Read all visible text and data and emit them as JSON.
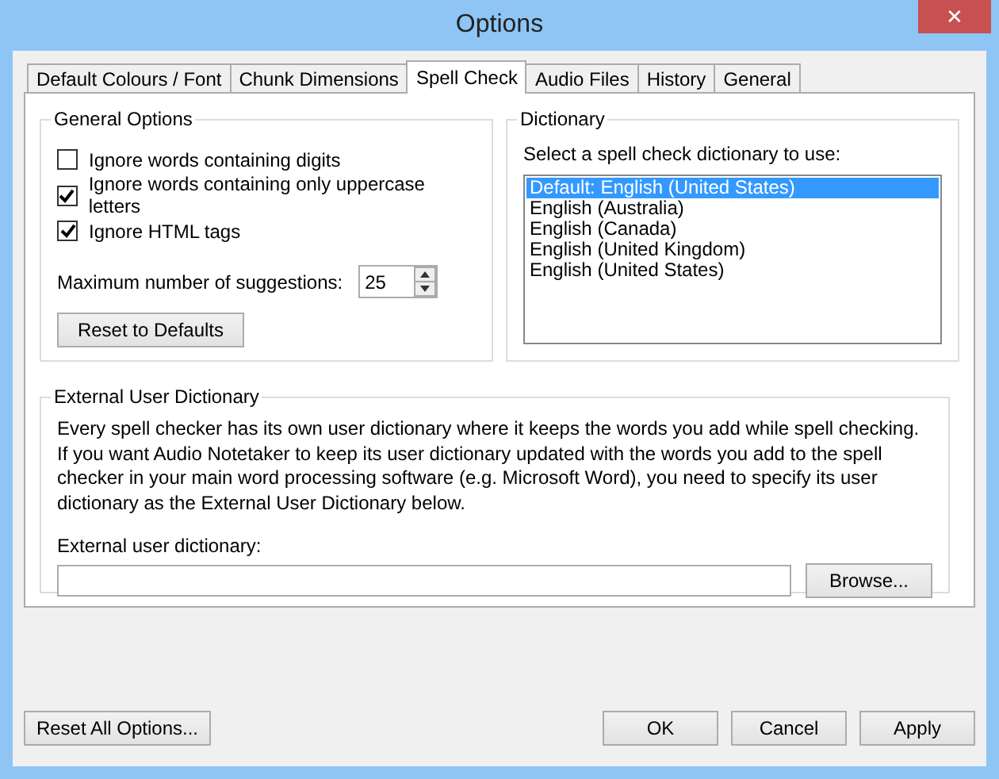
{
  "window": {
    "title": "Options",
    "close": "✕"
  },
  "tabs": [
    {
      "label": "Default Colours / Font",
      "selected": false
    },
    {
      "label": "Chunk Dimensions",
      "selected": false
    },
    {
      "label": "Spell Check",
      "selected": true
    },
    {
      "label": "Audio Files",
      "selected": false
    },
    {
      "label": "History",
      "selected": false
    },
    {
      "label": "General",
      "selected": false
    }
  ],
  "general_options": {
    "title": "General Options",
    "checkboxes": [
      {
        "label": "Ignore words containing digits",
        "checked": false
      },
      {
        "label": "Ignore words containing only uppercase letters",
        "checked": true
      },
      {
        "label": "Ignore HTML tags",
        "checked": true
      }
    ],
    "suggestions_label": "Maximum number of suggestions:",
    "suggestions_value": "25",
    "reset_button": "Reset to Defaults"
  },
  "dictionary": {
    "title": "Dictionary",
    "prompt": "Select a spell check dictionary to use:",
    "items": [
      {
        "label": "Default: English (United States)",
        "selected": true
      },
      {
        "label": "English (Australia)",
        "selected": false
      },
      {
        "label": "English (Canada)",
        "selected": false
      },
      {
        "label": "English (United Kingdom)",
        "selected": false
      },
      {
        "label": "English (United States)",
        "selected": false
      }
    ]
  },
  "external": {
    "title": "External User Dictionary",
    "description": "Every spell checker has its own user dictionary where it keeps the words you add while spell checking. If you want Audio Notetaker to keep its user dictionary updated with the words you add to the spell checker in your main word processing software (e.g. Microsoft Word), you need to specify its user dictionary as the External User Dictionary below.",
    "field_label": "External user dictionary:",
    "browse_button": "Browse..."
  },
  "footer": {
    "reset_all": "Reset All Options...",
    "buttons": [
      "OK",
      "Cancel",
      "Apply"
    ]
  }
}
